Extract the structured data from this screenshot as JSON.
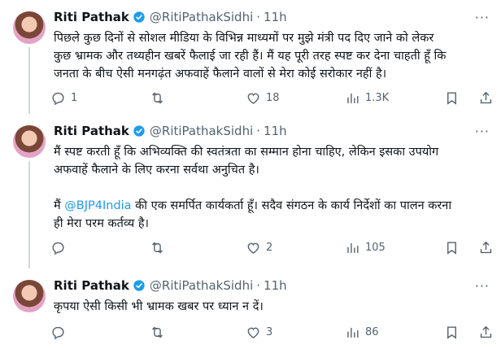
{
  "tweets": [
    {
      "name": "Riti Pathak",
      "handle": "@RitiPathakSidhi",
      "dot": "·",
      "time": "11h",
      "text_before": "पिछले कुछ दिनों से सोशल मीडिया के विभिन्न माध्यमों पर मुझे मंत्री पद दिए जाने को लेकर\nकुछ भ्रामक और तथ्यहीन खबरें फैलाई जा रही हैं। मैं यह पूरी तरह स्पष्ट कर देना चाहती हूँ कि\nजनता के बीच ऐसी मनगढ़ंत अफवाहें फैलाने वालों से मेरा कोई सरोकार नहीं है।",
      "replies": "1",
      "retweets": "",
      "likes": "18",
      "views": "1.3K"
    },
    {
      "name": "Riti Pathak",
      "handle": "@RitiPathakSidhi",
      "dot": "·",
      "time": "11h",
      "text_before": "मैं स्पष्ट करती हूँ कि अभिव्यक्ति की स्वतंत्रता का सम्मान होना चाहिए, लेकिन इसका उपयोग\nअफवाहें फैलाने के लिए करना सर्वथा अनुचित है।\n\nमैं ",
      "mention": "@BJP4India",
      "text_after": " की एक समर्पित कार्यकर्ता हूँ। सदैव संगठन के कार्य निर्देशों का पालन करना\nही मेरा परम कर्तव्य है।",
      "replies": "",
      "retweets": "",
      "likes": "2",
      "views": "105"
    },
    {
      "name": "Riti Pathak",
      "handle": "@RitiPathakSidhi",
      "dot": "·",
      "time": "11h",
      "text_before": "कृपया ऐसी किसी भी भ्रामक खबर पर ध्यान न दें।",
      "replies": "",
      "retweets": "",
      "likes": "3",
      "views": "86"
    }
  ],
  "more_label": "···",
  "colors": {
    "link": "#1d9bf0",
    "muted": "#536471",
    "verified": "#1d9bf0"
  },
  "icons": [
    "reply-icon",
    "retweet-icon",
    "like-icon",
    "views-icon",
    "bookmark-icon",
    "share-icon",
    "verified-badge-icon",
    "more-icon"
  ]
}
